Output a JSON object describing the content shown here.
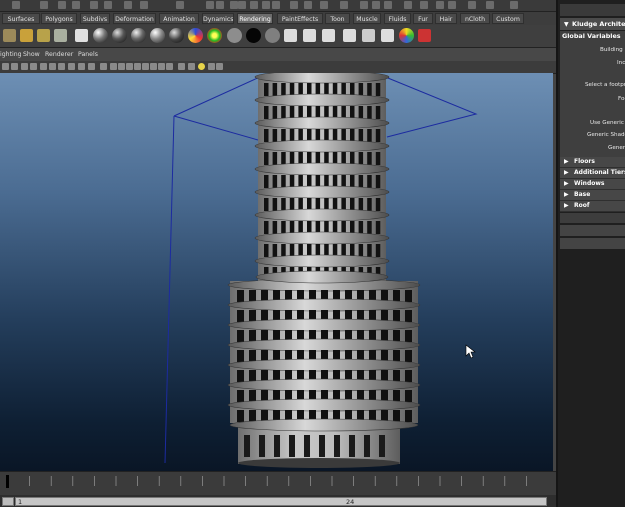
{
  "shelf_tabs": [
    {
      "label": "Surfaces",
      "active": false
    },
    {
      "label": "Polygons",
      "active": false
    },
    {
      "label": "Subdivs",
      "active": false
    },
    {
      "label": "Deformation",
      "active": false
    },
    {
      "label": "Animation",
      "active": false
    },
    {
      "label": "Dynamics",
      "active": false
    },
    {
      "label": "Rendering",
      "active": true
    },
    {
      "label": "PaintEffects",
      "active": false
    },
    {
      "label": "Toon",
      "active": false
    },
    {
      "label": "Muscle",
      "active": false
    },
    {
      "label": "Fluids",
      "active": false
    },
    {
      "label": "Fur",
      "active": false
    },
    {
      "label": "Hair",
      "active": false
    },
    {
      "label": "nCloth",
      "active": false
    },
    {
      "label": "Custom",
      "active": false
    }
  ],
  "panel_menus": [
    "ighting",
    "Show",
    "Renderer",
    "Panels"
  ],
  "time_slider": {
    "start_frame": "1",
    "end_frame": "24"
  },
  "right_panel": {
    "window_title": "Kludge Architect",
    "section_title": "Global Variables",
    "labels": [
      "Building",
      "Incr",
      "Select a footprin",
      "Foo",
      "Use Generic S",
      "Generic Shader",
      "Genera"
    ],
    "collapsed_sections": [
      "Floors",
      "Additional Tiers",
      "Windows",
      "Base",
      "Roof"
    ]
  },
  "colors": {
    "viewport_top": "#6d8fb4",
    "viewport_bottom": "#0a1626",
    "wireframe": "#1c2ba0",
    "building": "#b8b8b8"
  }
}
